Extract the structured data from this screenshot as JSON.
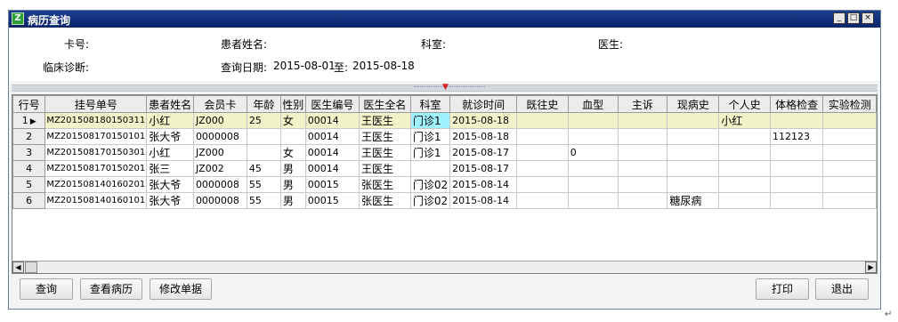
{
  "window": {
    "title": "病历查询",
    "controls": {
      "minimize": "_",
      "maximize": "□",
      "close": "×"
    }
  },
  "filters": {
    "card_label": "卡号:",
    "patient_name_label": "患者姓名:",
    "department_label": "科室:",
    "doctor_label": "医生:",
    "diagnosis_label": "临床诊断:",
    "date_label": "查询日期:",
    "date_from": "2015-08-01",
    "date_to_label": "至:",
    "date_to": "2015-08-18"
  },
  "grid": {
    "columns": [
      "行号",
      "挂号单号",
      "患者姓名",
      "会员卡",
      "年龄",
      "性别",
      "医生编号",
      "医生全名",
      "科室",
      "就诊时间",
      "既往史",
      "血型",
      "主诉",
      "现病史",
      "个人史",
      "体格检查",
      "实验检测"
    ],
    "rows": [
      [
        "1",
        "MZ201508180150311",
        "小红",
        "JZ000",
        "25",
        "女",
        "00014",
        "王医生",
        "门诊1",
        "2015-08-18",
        "",
        "",
        "",
        "",
        "小红",
        "",
        ""
      ],
      [
        "2",
        "MZ201508170150101",
        "张大爷",
        "0000008",
        "",
        "",
        "00014",
        "王医生",
        "门诊1",
        "2015-08-18",
        "",
        "",
        "",
        "",
        "",
        "112123",
        ""
      ],
      [
        "3",
        "MZ201508170150301",
        "小红",
        "JZ000",
        "",
        "女",
        "00014",
        "王医生",
        "门诊1",
        "2015-08-17",
        "",
        "0",
        "",
        "",
        "",
        "",
        ""
      ],
      [
        "4",
        "MZ201508170150201",
        "张三",
        "JZ002",
        "45",
        "男",
        "00014",
        "王医生",
        "",
        "2015-08-17",
        "",
        "",
        "",
        "",
        "",
        "",
        ""
      ],
      [
        "5",
        "MZ201508140160201",
        "张大爷",
        "0000008",
        "55",
        "男",
        "00015",
        "张医生",
        "门诊02",
        "2015-08-14",
        "",
        "",
        "",
        "",
        "",
        "",
        ""
      ],
      [
        "6",
        "MZ201508140160101",
        "张大爷",
        "0000008",
        "55",
        "男",
        "00015",
        "张医生",
        "门诊02",
        "2015-08-14",
        "",
        "",
        "",
        "糖尿病",
        "",
        "",
        ""
      ]
    ],
    "selected_row_index": 0,
    "current_row_marker": "▶"
  },
  "buttons": {
    "search": "查询",
    "view_record": "查看病历",
    "edit_form": "修改单据",
    "print": "打印",
    "exit": "退出"
  },
  "colors": {
    "title_bar": "#0a246a",
    "selected_row": "#f2f2c8",
    "highlight_cell": "#9ff3ff"
  }
}
